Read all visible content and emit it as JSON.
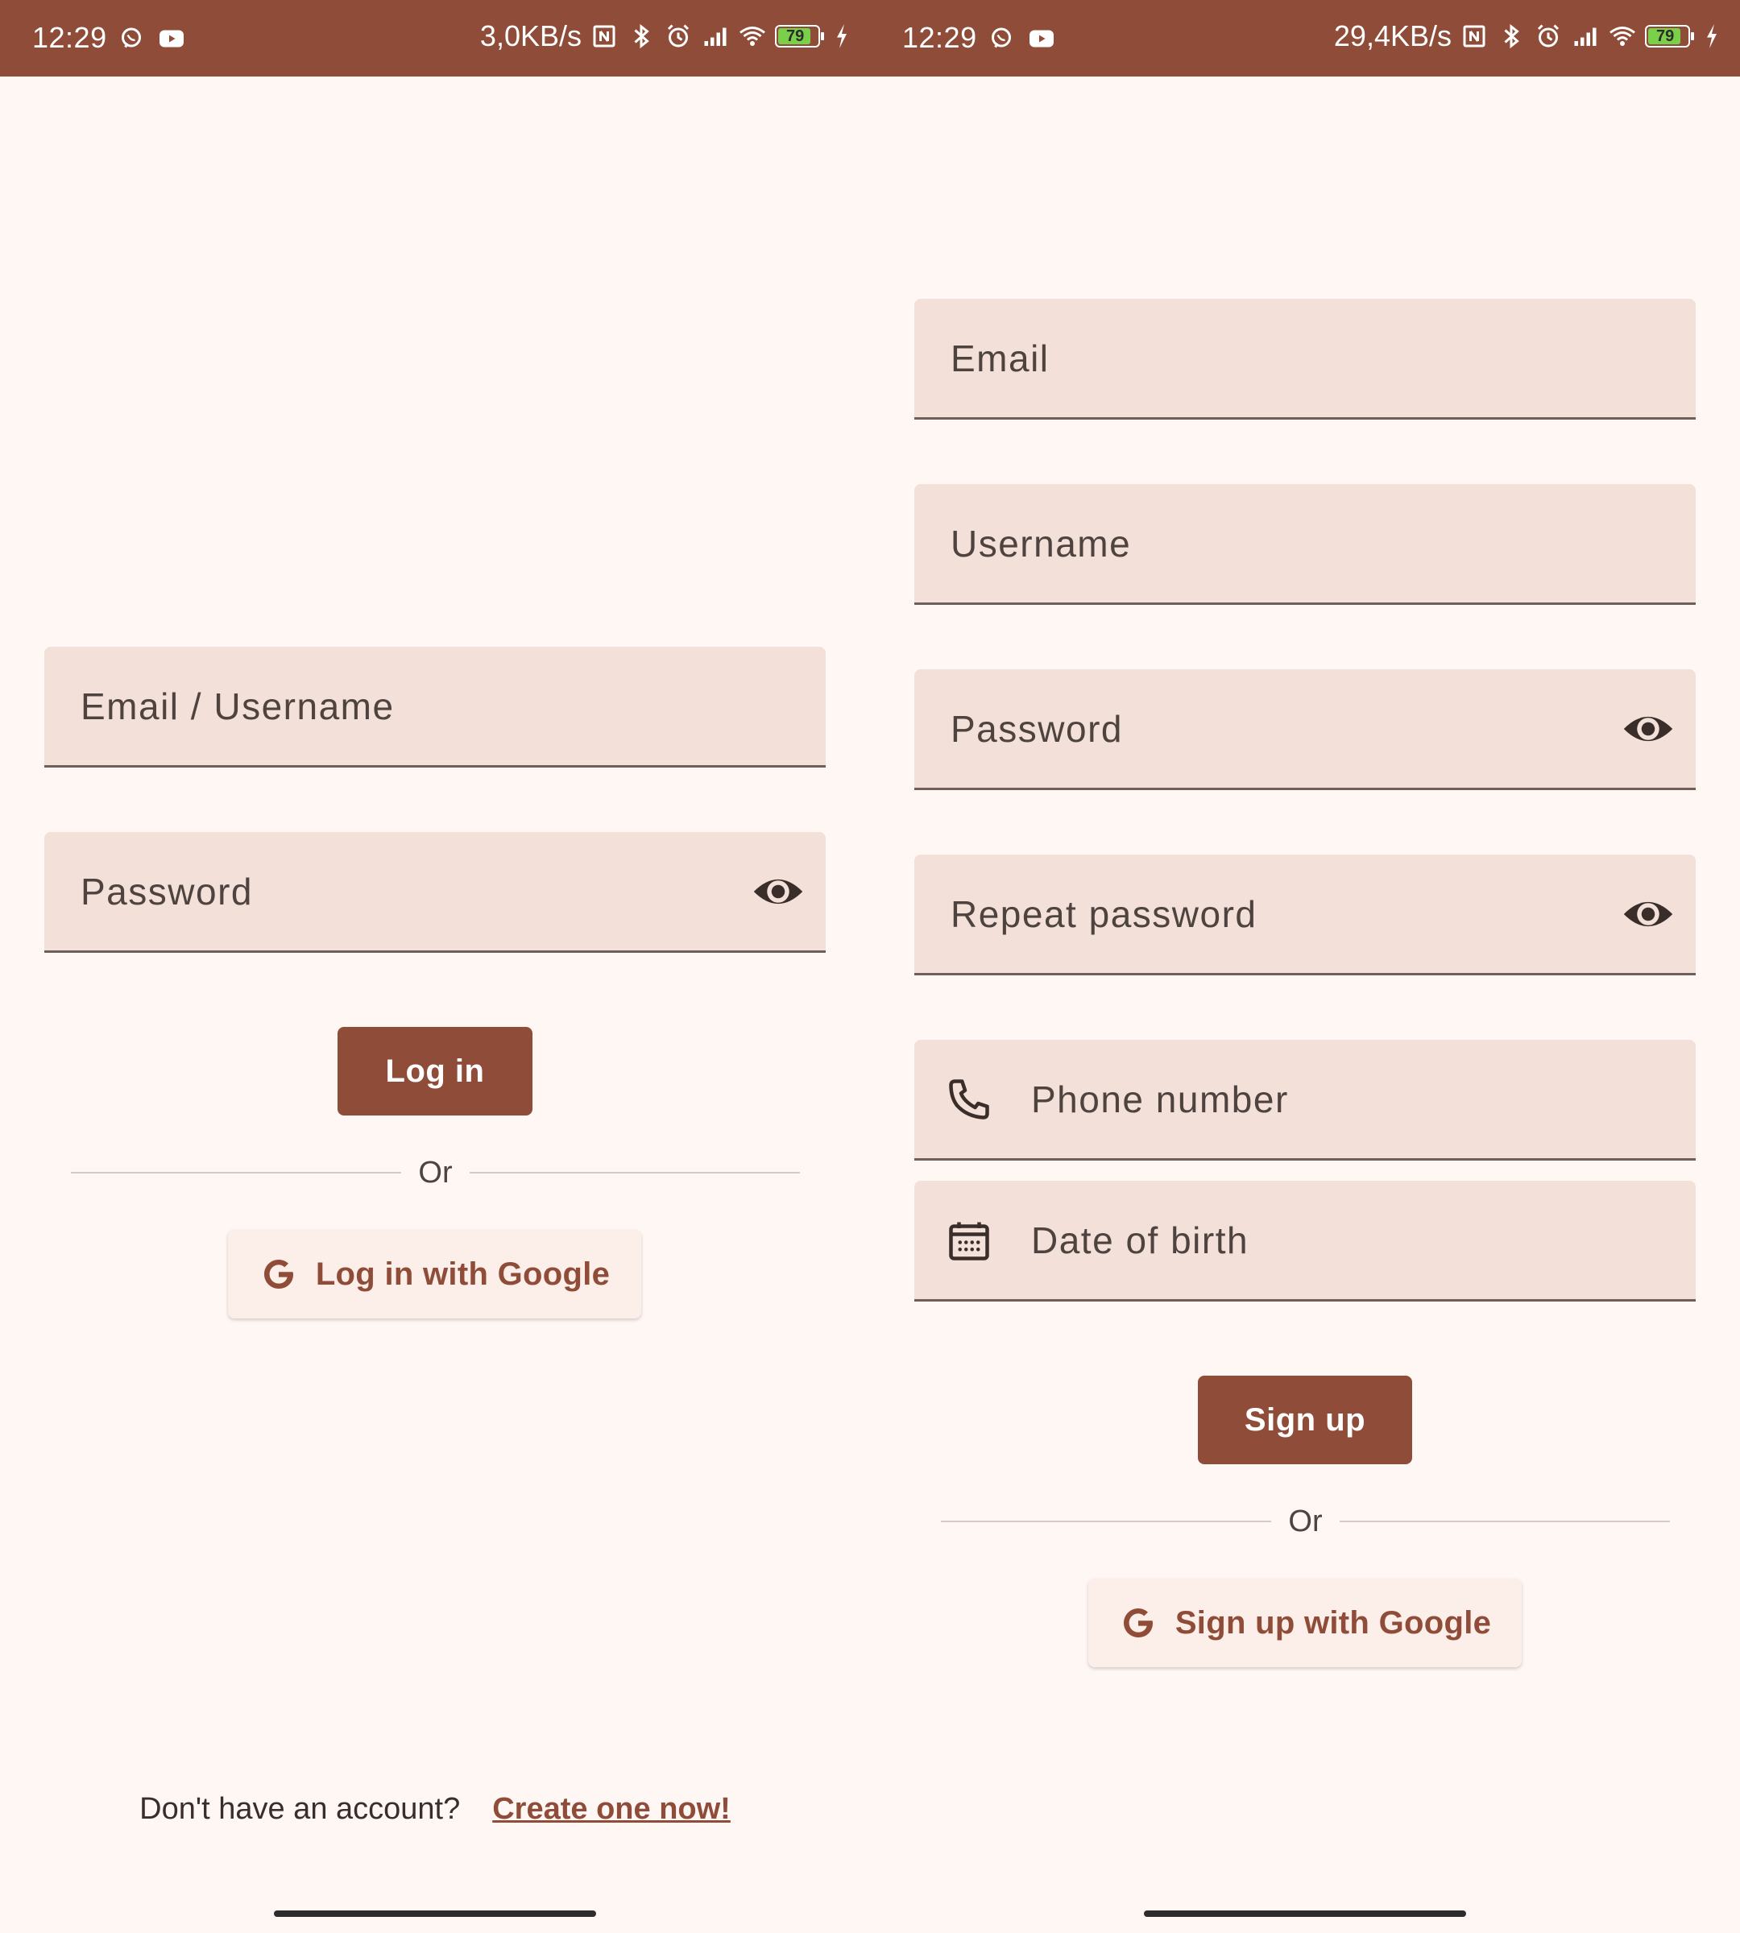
{
  "colors": {
    "status_bar": "#8F4C38",
    "background": "#FFF7F4",
    "field_fill": "#F2E0D9",
    "primary": "#8F4C38",
    "google_button_fill": "#FCEEE9"
  },
  "login_screen": {
    "status_bar": {
      "time": "12:29",
      "network_speed": "3,0KB/s",
      "battery_level": "79",
      "icons": [
        "whatsapp-icon",
        "youtube-icon",
        "nfc-icon",
        "bluetooth-icon",
        "alarm-icon",
        "signal-icon",
        "wifi-icon",
        "battery-icon",
        "charging-icon"
      ]
    },
    "fields": {
      "email_username": {
        "label": "Email / Username"
      },
      "password": {
        "label": "Password",
        "trailing_icon": "eye-icon"
      }
    },
    "login_button": "Log in",
    "divider_text": "Or",
    "google_button": {
      "label": "Log in with Google",
      "icon": "google-icon"
    },
    "footer": {
      "prompt": "Don't have an account?",
      "link": "Create one now!"
    }
  },
  "signup_screen": {
    "status_bar": {
      "time": "12:29",
      "network_speed": "29,4KB/s",
      "battery_level": "79",
      "icons": [
        "whatsapp-icon",
        "youtube-icon",
        "nfc-icon",
        "bluetooth-icon",
        "alarm-icon",
        "signal-icon",
        "wifi-icon",
        "battery-icon",
        "charging-icon"
      ]
    },
    "fields": {
      "email": {
        "label": "Email"
      },
      "username": {
        "label": "Username"
      },
      "password": {
        "label": "Password",
        "trailing_icon": "eye-icon"
      },
      "repeat_password": {
        "label": "Repeat password",
        "trailing_icon": "eye-icon"
      },
      "phone_number": {
        "label": "Phone number",
        "leading_icon": "phone-icon"
      },
      "date_of_birth": {
        "label": "Date of birth",
        "leading_icon": "calendar-icon"
      }
    },
    "signup_button": "Sign up",
    "divider_text": "Or",
    "google_button": {
      "label": "Sign up with Google",
      "icon": "google-icon"
    }
  }
}
